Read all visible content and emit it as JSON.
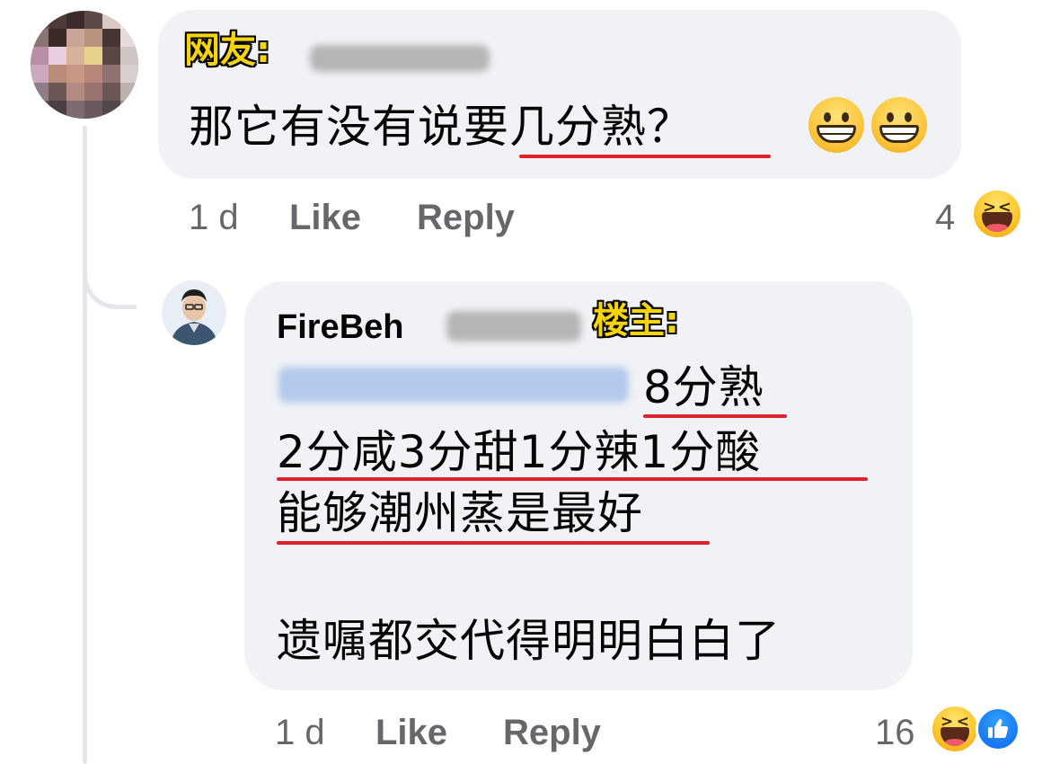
{
  "comments": [
    {
      "tag": "网友:",
      "text": "那它有没有说要几分熟？",
      "emoji": [
        "grinning-face",
        "grinning-face"
      ],
      "time": "1 d",
      "like_label": "Like",
      "reply_label": "Reply",
      "reaction_count": "4",
      "reactions": [
        "haha"
      ]
    }
  ],
  "reply": {
    "author": "FireBeh",
    "tag": "楼主:",
    "line_1": "8分熟",
    "line_2": "2分咸3分甜1分辣1分酸",
    "line_3": "能够潮州蒸是最好",
    "line_4": "遗嘱都交代得明明白白了",
    "time": "1 d",
    "like_label": "Like",
    "reply_label": "Reply",
    "reaction_count": "16",
    "reactions": [
      "haha",
      "like"
    ]
  },
  "colors": {
    "bubble": "#f0f2f5",
    "meta_text": "#65676b",
    "body_text": "#050505",
    "underline": "#e0202b",
    "tag_fill": "#f6d40c",
    "like_blue": "#1877f2",
    "mention_blur": "#b3c8ec"
  }
}
